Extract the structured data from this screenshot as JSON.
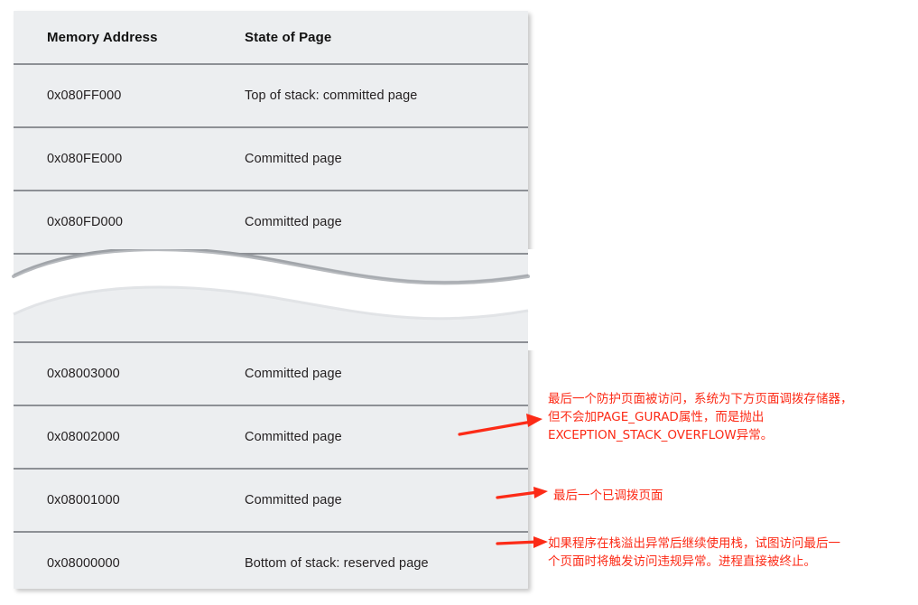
{
  "table": {
    "columns": [
      {
        "key": "address",
        "label": "Memory Address"
      },
      {
        "key": "state",
        "label": "State of Page"
      }
    ],
    "upper_rows": [
      {
        "address": "0x080FF000",
        "state": "Top of stack: committed page"
      },
      {
        "address": "0x080FE000",
        "state": "Committed page"
      },
      {
        "address": "0x080FD000",
        "state": "Committed page"
      }
    ],
    "lower_rows": [
      {
        "address": "0x08003000",
        "state": "Committed page"
      },
      {
        "address": "0x08002000",
        "state": "Committed page"
      },
      {
        "address": "0x08001000",
        "state": "Committed page"
      },
      {
        "address": "0x08000000",
        "state": "Bottom of stack: reserved page"
      }
    ],
    "break_marker": "wavy-page-break"
  },
  "annotations": [
    {
      "id": "guard-page-accessed",
      "text": "最后一个防护页面被访问，系统为下方页面调拨存储器，\n但不会加PAGE_GURAD属性，而是抛出\nEXCEPTION_STACK_OVERFLOW异常。",
      "arrow": "arrow-right-icon",
      "target_row_address": "0x08002000"
    },
    {
      "id": "last-committed-page",
      "text": "最后一个已调拨页面",
      "arrow": "arrow-right-icon",
      "target_row_address": "0x08001000"
    },
    {
      "id": "access-violation",
      "text": "如果程序在栈溢出异常后继续使用栈，试图访问最后一\n个页面时将触发访问违规异常。进程直接被终止。",
      "arrow": "arrow-right-icon",
      "target_row_address": "0x08000000"
    }
  ],
  "colors": {
    "cell_background": "#eceef0",
    "row_separator": "#8d9095",
    "column_divider": "#9a9da2",
    "annotation_red": "#fc2b17",
    "text": "#231f20",
    "page_background": "#ffffff"
  }
}
